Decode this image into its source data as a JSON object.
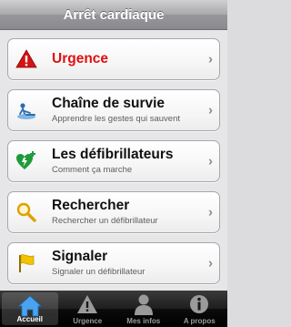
{
  "navbar": {
    "title": "Arrêt cardiaque"
  },
  "rows": [
    {
      "title": "Urgence",
      "icon": "warning-triangle-icon",
      "color": "#e01010"
    },
    {
      "title": "Chaîne de survie",
      "subtitle": "Apprendre les gestes qui sauvent",
      "icon": "cpr-person-icon"
    },
    {
      "title": "Les défibrillateurs",
      "subtitle": "Comment ça marche",
      "icon": "heart-plus-icon"
    },
    {
      "title": "Rechercher",
      "subtitle": "Rechercher un défibrillateur",
      "icon": "magnifier-icon"
    },
    {
      "title": "Signaler",
      "subtitle": "Signaler un défibrillateur",
      "icon": "flag-icon"
    }
  ],
  "tabs": [
    {
      "label": "Accueil",
      "icon": "home-icon",
      "active": true
    },
    {
      "label": "Urgence",
      "icon": "warning-icon"
    },
    {
      "label": "Mes infos",
      "icon": "person-icon"
    },
    {
      "label": "A propos",
      "icon": "info-icon"
    }
  ],
  "chevron": "›"
}
